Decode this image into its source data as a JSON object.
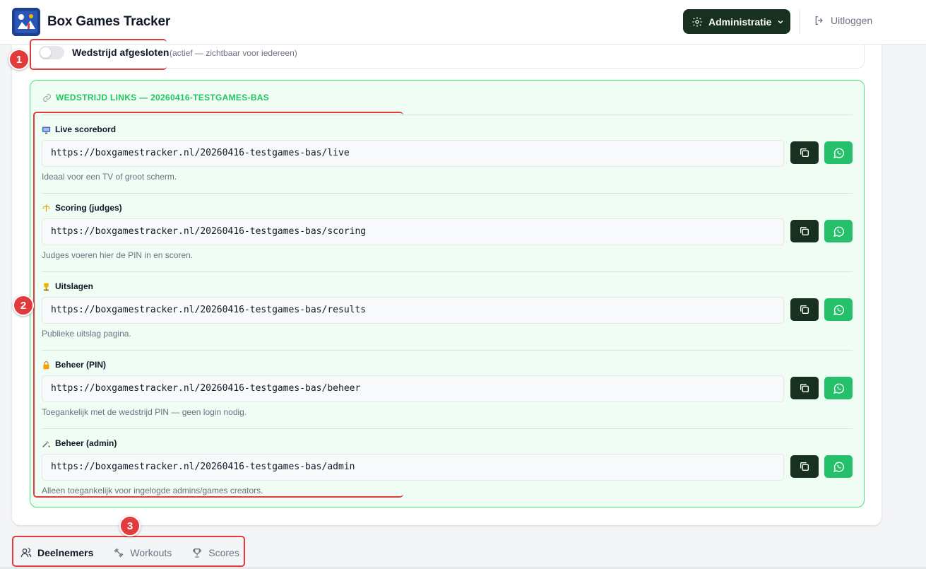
{
  "header": {
    "app_title": "Box Games Tracker",
    "admin_label": "Administratie",
    "logout_label": "Uitloggen"
  },
  "status": {
    "toggle_label": "Wedstrijd afgesloten",
    "toggle_note": "(actief — zichtbaar voor iedereen)",
    "toggle_on": false
  },
  "links": {
    "title": "WEDSTRIJD LINKS — 20260416-TESTGAMES-BAS",
    "items": [
      {
        "icon": "tv-icon",
        "label": "Live scorebord",
        "url": "https://boxgamestracker.nl/20260416-testgames-bas/live",
        "desc": "Ideaal voor een TV of groot scherm."
      },
      {
        "icon": "judge-icon",
        "label": "Scoring (judges)",
        "url": "https://boxgamestracker.nl/20260416-testgames-bas/scoring",
        "desc": "Judges voeren hier de PIN in en scoren."
      },
      {
        "icon": "trophy-icon",
        "label": "Uitslagen",
        "url": "https://boxgamestracker.nl/20260416-testgames-bas/results",
        "desc": "Publieke uitslag pagina."
      },
      {
        "icon": "lock-icon",
        "label": "Beheer (PIN)",
        "url": "https://boxgamestracker.nl/20260416-testgames-bas/beheer",
        "desc": "Toegankelijk met de wedstrijd PIN — geen login nodig."
      },
      {
        "icon": "tools-icon",
        "label": "Beheer (admin)",
        "url": "https://boxgamestracker.nl/20260416-testgames-bas/admin",
        "desc": "Alleen toegankelijk voor ingelogde admins/games creators."
      }
    ]
  },
  "tabs": [
    {
      "label": "Deelnemers",
      "active": true
    },
    {
      "label": "Workouts",
      "active": false
    },
    {
      "label": "Scores",
      "active": false
    }
  ],
  "annotations": [
    "1",
    "2",
    "3"
  ],
  "colors": {
    "accent_dark": "#17301f",
    "whatsapp_green": "#25c16a",
    "link_green": "#22c55e",
    "annotation_red": "#e23b3b"
  }
}
